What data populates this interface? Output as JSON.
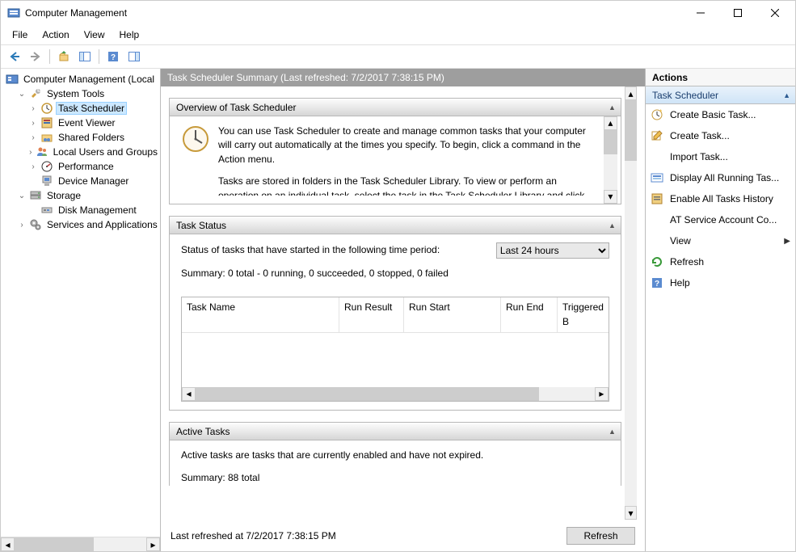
{
  "window": {
    "title": "Computer Management"
  },
  "menu": {
    "file": "File",
    "action": "Action",
    "view": "View",
    "help": "Help"
  },
  "tree": {
    "root": "Computer Management (Local",
    "system_tools": "System Tools",
    "task_scheduler": "Task Scheduler",
    "event_viewer": "Event Viewer",
    "shared_folders": "Shared Folders",
    "local_users": "Local Users and Groups",
    "performance": "Performance",
    "device_manager": "Device Manager",
    "storage": "Storage",
    "disk_management": "Disk Management",
    "services_apps": "Services and Applications"
  },
  "center": {
    "title": "Task Scheduler Summary (Last refreshed: 7/2/2017 7:38:15 PM)",
    "overview": {
      "header": "Overview of Task Scheduler",
      "p1": "You can use Task Scheduler to create and manage common tasks that your computer will carry out automatically at the times you specify. To begin, click a command in the Action menu.",
      "p2": "Tasks are stored in folders in the Task Scheduler Library. To view or perform an operation on an individual task, select the task in the Task Scheduler Library and click on a command in the Action menu."
    },
    "task_status": {
      "header": "Task Status",
      "period_label": "Status of tasks that have started in the following time period:",
      "period_value": "Last 24 hours",
      "summary": "Summary: 0 total - 0 running, 0 succeeded, 0 stopped, 0 failed",
      "columns": {
        "task_name": "Task Name",
        "run_result": "Run Result",
        "run_start": "Run Start",
        "run_end": "Run End",
        "triggered": "Triggered B"
      }
    },
    "active_tasks": {
      "header": "Active Tasks",
      "p1": "Active tasks are tasks that are currently enabled and have not expired.",
      "summary": "Summary: 88 total"
    },
    "footer": {
      "last_refreshed": "Last refreshed at 7/2/2017 7:38:15 PM",
      "refresh": "Refresh"
    }
  },
  "actions": {
    "header": "Actions",
    "sub": "Task Scheduler",
    "items": {
      "create_basic": "Create Basic Task...",
      "create_task": "Create Task...",
      "import_task": "Import Task...",
      "display_running": "Display All Running Tas...",
      "enable_history": "Enable All Tasks History",
      "at_service": "AT Service Account Co...",
      "view": "View",
      "refresh": "Refresh",
      "help": "Help"
    }
  }
}
